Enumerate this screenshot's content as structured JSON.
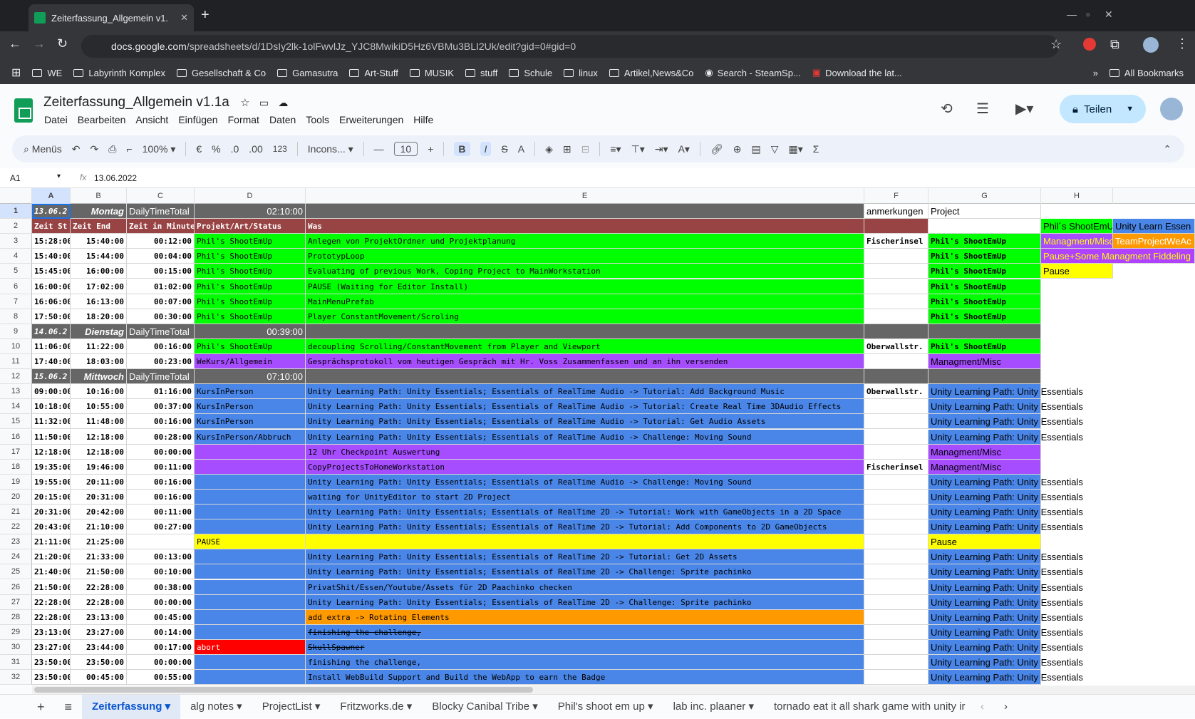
{
  "browser": {
    "tab_title": "Zeiterfassung_Allgemein v1.",
    "url_host": "docs.google.com",
    "url_path": "/spreadsheets/d/1DsIy2lk-1olFwvlJz_YJC8MwikiD5Hz6VBMu3BLI2Uk/edit?gid=0#gid=0",
    "bookmarks": [
      "WE",
      "Labyrinth Komplex",
      "Gesellschaft & Co",
      "Gamasutra",
      "Art-Stuff",
      "MUSIK",
      "stuff",
      "Schule",
      "linux",
      "Artikel,News&Co",
      "Search - SteamSp...",
      "Download the lat..."
    ],
    "all_bookmarks": "All Bookmarks"
  },
  "doc": {
    "title": "Zeiterfassung_Allgemein v1.1a",
    "menus": [
      "Datei",
      "Bearbeiten",
      "Ansicht",
      "Einfügen",
      "Format",
      "Daten",
      "Tools",
      "Erweiterungen",
      "Hilfe"
    ],
    "share_label": "Teilen"
  },
  "toolbar": {
    "search": "Menüs",
    "zoom": "100%",
    "currency": "€",
    "percent": "%",
    "dec_less": ".0",
    "dec_more": ".00",
    "fmt": "123",
    "font": "Incons...",
    "font_size": "10"
  },
  "formula": {
    "cell_ref": "A1",
    "fx": "fx",
    "value": "13.06.2022"
  },
  "columns": [
    {
      "l": "A"
    },
    {
      "l": "B"
    },
    {
      "l": "C"
    },
    {
      "l": "D"
    },
    {
      "l": "E"
    },
    {
      "l": "F"
    },
    {
      "l": "G"
    },
    {
      "l": "H"
    }
  ],
  "rows": [
    {
      "n": "1",
      "type": "day",
      "a": "13.06.2",
      "b": "Montag",
      "c": "DailyTimeTotal",
      "d": "02:10:00",
      "f": "anmerkungen",
      "g": "Project"
    },
    {
      "n": "2",
      "type": "head",
      "a": "Zeit St",
      "b": "Zeit End",
      "c": "Zeit in Minute",
      "d": "Projekt/Art/Status",
      "e": "Was",
      "h": "Phil´s ShootEmU",
      "i": "Unity Learn Essen"
    },
    {
      "n": "3",
      "a": "15:28:00",
      "b": "15:40:00",
      "c": "00:12:00",
      "d": "Phil's ShootEmUp",
      "e": "Anlegen von ProjektOrdner und Projektplanung",
      "f": "Fischerinsel",
      "g": "Phil's ShootEmUp",
      "col": "G",
      "h": "Managment/Misc",
      "hc": "P",
      "i": "TeamProjectWeAc",
      "ic": "O"
    },
    {
      "n": "4",
      "a": "15:40:00",
      "b": "15:44:00",
      "c": "00:04:00",
      "d": "Phil's ShootEmUp",
      "e": "PrototypLoop",
      "g": "Phil's ShootEmUp",
      "col": "G",
      "h": "Pause+Some Managment Fiddeling",
      "hc": "P2"
    },
    {
      "n": "5",
      "a": "15:45:00",
      "b": "16:00:00",
      "c": "00:15:00",
      "d": "Phil's ShootEmUp",
      "e": "Evaluating of previous Work, Coping Project to MainWorkstation",
      "g": "Phil's ShootEmUp",
      "col": "G",
      "h": "Pause",
      "hc": "Y"
    },
    {
      "n": "6",
      "a": "16:00:00",
      "b": "17:02:00",
      "c": "01:02:00",
      "d": "Phil's ShootEmUp",
      "e": "PAUSE (Waiting for Editor Install)",
      "g": "Phil's ShootEmUp",
      "col": "G"
    },
    {
      "n": "7",
      "a": "16:06:00",
      "b": "16:13:00",
      "c": "00:07:00",
      "d": "Phil's ShootEmUp",
      "e": "MainMenuPrefab",
      "g": "Phil's ShootEmUp",
      "col": "G"
    },
    {
      "n": "8",
      "a": "17:50:00",
      "b": "18:20:00",
      "c": "00:30:00",
      "d": "Phil's ShootEmUp",
      "e": "Player ConstantMovement/Scroling",
      "g": "Phil's ShootEmUp",
      "col": "G"
    },
    {
      "n": "9",
      "type": "day",
      "a": "14.06.2",
      "b": "Dienstag",
      "c": "DailyTimeTotal",
      "d": "00:39:00"
    },
    {
      "n": "10",
      "a": "11:06:00",
      "b": "11:22:00",
      "c": "00:16:00",
      "d": "Phil's ShootEmUp",
      "e": "decoupling Scrolling/ConstantMovement from Player and Viewport",
      "f": "Oberwallstr.",
      "g": "Phil's ShootEmUp",
      "col": "G"
    },
    {
      "n": "11",
      "a": "17:40:00",
      "b": "18:03:00",
      "c": "00:23:00",
      "d": "WeKurs/Allgemein",
      "e": "Gesprächsprotokoll vom heutigen Gespräch mit Hr. Voss Zusammenfassen und an ihn versenden",
      "g": "Managment/Misc",
      "col": "P"
    },
    {
      "n": "12",
      "type": "day",
      "a": "15.06.2",
      "b": "Mittwoch",
      "c": "DailyTimeTotal",
      "d": "07:10:00"
    },
    {
      "n": "13",
      "a": "09:00:00",
      "b": "10:16:00",
      "c": "01:16:00",
      "d": "KursInPerson",
      "e": "Unity Learning Path: Unity Essentials; Essentials of RealTime Audio -> Tutorial: Add Background Music",
      "f": "Oberwallstr.",
      "g": "Unity Learning Path: Unity Essentials",
      "col": "B"
    },
    {
      "n": "14",
      "a": "10:18:00",
      "b": "10:55:00",
      "c": "00:37:00",
      "d": "KursInPerson",
      "e": "Unity Learning Path: Unity Essentials; Essentials of RealTime Audio -> Tutorial: Create Real Time 3DAudio Effects",
      "g": "Unity Learning Path: Unity Essentials",
      "col": "B"
    },
    {
      "n": "15",
      "a": "11:32:00",
      "b": "11:48:00",
      "c": "00:16:00",
      "d": "KursInPerson",
      "e": "Unity Learning Path: Unity Essentials; Essentials of RealTime Audio -> Tutorial: Get Audio Assets",
      "g": "Unity Learning Path: Unity Essentials",
      "col": "B"
    },
    {
      "n": "16",
      "a": "11:50:00",
      "b": "12:18:00",
      "c": "00:28:00",
      "d": "KursInPerson/Abbruch",
      "e": "Unity Learning Path: Unity Essentials; Essentials of RealTime Audio -> Challenge: Moving Sound",
      "g": "Unity Learning Path: Unity Essentials",
      "col": "B"
    },
    {
      "n": "17",
      "a": "12:18:00",
      "b": "12:18:00",
      "c": "00:00:00",
      "d": "",
      "e": "12 Uhr Checkpoint Auswertung",
      "g": "Managment/Misc",
      "col": "P"
    },
    {
      "n": "18",
      "a": "19:35:00",
      "b": "19:46:00",
      "c": "00:11:00",
      "d": "",
      "e": "CopyProjectsToHomeWorkstation",
      "f": "Fischerinsel",
      "g": "Managment/Misc",
      "col": "P"
    },
    {
      "n": "19",
      "a": "19:55:00",
      "b": "20:11:00",
      "c": "00:16:00",
      "d": "",
      "e": "Unity Learning Path: Unity Essentials; Essentials of RealTime Audio -> Challenge: Moving Sound",
      "g": "Unity Learning Path: Unity Essentials",
      "col": "B"
    },
    {
      "n": "20",
      "a": "20:15:00",
      "b": "20:31:00",
      "c": "00:16:00",
      "d": "",
      "e": "waiting for UnityEditor to start 2D Project",
      "g": "Unity Learning Path: Unity Essentials",
      "col": "B"
    },
    {
      "n": "21",
      "a": "20:31:00",
      "b": "20:42:00",
      "c": "00:11:00",
      "d": "",
      "e": "Unity Learning Path: Unity Essentials; Essentials of RealTime 2D -> Tutorial: Work with GameObjects in a 2D Space",
      "g": "Unity Learning Path: Unity Essentials",
      "col": "B"
    },
    {
      "n": "22",
      "a": "20:43:00",
      "b": "21:10:00",
      "c": "00:27:00",
      "d": "",
      "e": "Unity Learning Path: Unity Essentials; Essentials of RealTime 2D -> Tutorial: Add Components to 2D GameObjects",
      "g": "Unity Learning Path: Unity Essentials",
      "col": "B"
    },
    {
      "n": "23",
      "a": "21:11:00",
      "b": "21:25:00",
      "c": "",
      "d": "PAUSE",
      "e": "",
      "g": "Pause",
      "col": "Y"
    },
    {
      "n": "24",
      "a": "21:20:00",
      "b": "21:33:00",
      "c": "00:13:00",
      "d": "",
      "e": "Unity Learning Path: Unity Essentials; Essentials of RealTime 2D -> Tutorial: Get 2D Assets",
      "g": "Unity Learning Path: Unity Essentials",
      "col": "B"
    },
    {
      "n": "25",
      "a": "21:40:00",
      "b": "21:50:00",
      "c": "00:10:00",
      "d": "",
      "e": "Unity Learning Path: Unity Essentials; Essentials of RealTime 2D -> Challenge: Sprite pachinko",
      "g": "Unity Learning Path: Unity Essentials",
      "col": "B"
    },
    {
      "n": "26",
      "a": "21:50:00",
      "b": "22:28:00",
      "c": "00:38:00",
      "d": "",
      "e": "PrivatShit/Essen/Youtube/Assets für 2D Paachinko checken",
      "g": "Unity Learning Path: Unity Essentials",
      "col": "B"
    },
    {
      "n": "27",
      "a": "22:28:00",
      "b": "22:28:00",
      "c": "00:00:00",
      "d": "",
      "e": "Unity Learning Path: Unity Essentials; Essentials of RealTime 2D -> Challenge: Sprite pachinko",
      "g": "Unity Learning Path: Unity Essentials",
      "col": "B"
    },
    {
      "n": "28",
      "a": "22:28:00",
      "b": "23:13:00",
      "c": "00:45:00",
      "d": "",
      "e": "add extra -> Rotating Elements",
      "ec": "O",
      "g": "Unity Learning Path: Unity Essentials",
      "col": "B"
    },
    {
      "n": "29",
      "a": "23:13:00",
      "b": "23:27:00",
      "c": "00:14:00",
      "d": "",
      "e": "finishing the challenge,",
      "strike": true,
      "g": "Unity Learning Path: Unity Essentials",
      "col": "B"
    },
    {
      "n": "30",
      "a": "23:27:00",
      "b": "23:44:00",
      "c": "00:17:00",
      "d": "abort",
      "e": "SkullSpawner",
      "strike": true,
      "dcR": true,
      "g": "Unity Learning Path: Unity Essentials",
      "col": "B"
    },
    {
      "n": "31",
      "a": "23:50:00",
      "b": "23:50:00",
      "c": "00:00:00",
      "d": "",
      "e": "finishing the challenge,",
      "g": "Unity Learning Path: Unity Essentials",
      "col": "B"
    },
    {
      "n": "32",
      "a": "23:50:00",
      "b": "00:45:00",
      "c": "00:55:00",
      "d": "",
      "e": "Install WebBuild Support and Build the WebApp to earn the Badge",
      "g": "Unity Learning Path: Unity Essentials",
      "col": "B"
    }
  ],
  "sheets": [
    "Zeiterfassung",
    "alg notes",
    "ProjectList",
    "Fritzworks.de",
    "Blocky Canibal Tribe",
    "Phil's shoot em up",
    "lab inc. plaaner",
    "tornado eat it all shark game with unity ir"
  ],
  "colors": {
    "green": "#00ff00",
    "purple": "#9900ff",
    "blue": "#4a86e8",
    "yellow": "#ffff00",
    "orange": "#ff9900",
    "red": "#ff0000",
    "day_row": "#666666",
    "header_row": "#994444"
  }
}
